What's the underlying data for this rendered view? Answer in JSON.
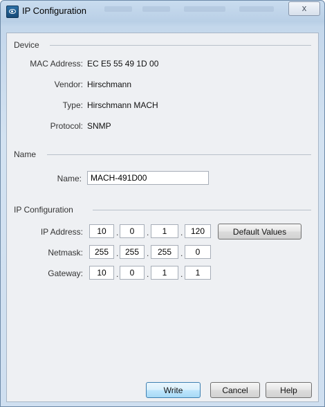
{
  "window": {
    "title": "IP Configuration",
    "close_symbol": "x"
  },
  "device": {
    "section_title": "Device",
    "mac_label": "MAC Address:",
    "mac_value": "EC E5 55 49 1D 00",
    "vendor_label": "Vendor:",
    "vendor_value": "Hirschmann",
    "type_label": "Type:",
    "type_value": "Hirschmann MACH",
    "protocol_label": "Protocol:",
    "protocol_value": "SNMP"
  },
  "name": {
    "section_title": "Name",
    "name_label": "Name:",
    "name_value": "MACH-491D00"
  },
  "ip": {
    "section_title": "IP Configuration",
    "ip_label": "IP Address:",
    "ip_octets": [
      "10",
      "0",
      "1",
      "120"
    ],
    "netmask_label": "Netmask:",
    "netmask_octets": [
      "255",
      "255",
      "255",
      "0"
    ],
    "gateway_label": "Gateway:",
    "gateway_octets": [
      "10",
      "0",
      "1",
      "1"
    ],
    "dot": ".",
    "default_values_label": "Default Values"
  },
  "buttons": {
    "write": "Write",
    "cancel": "Cancel",
    "help": "Help"
  }
}
